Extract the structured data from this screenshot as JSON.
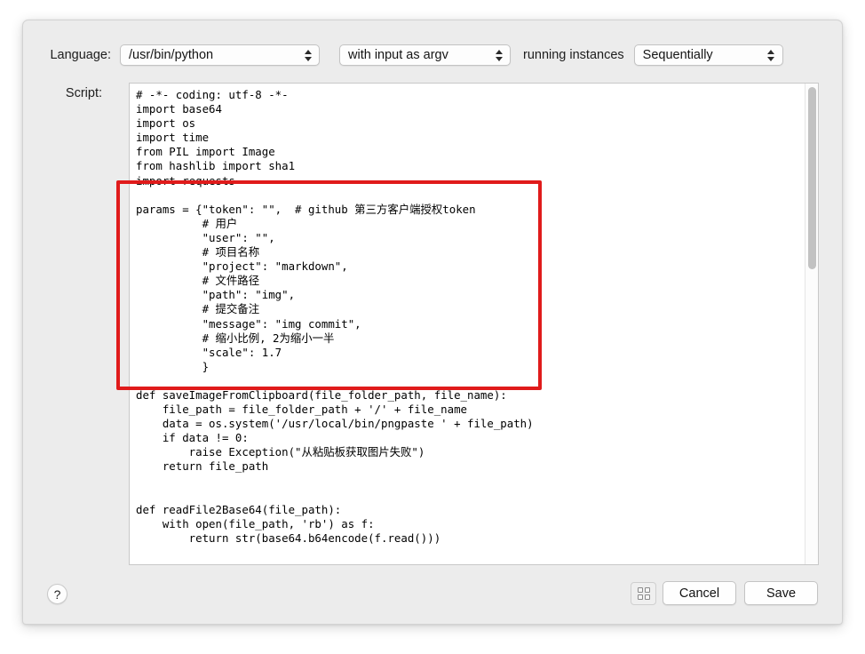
{
  "window": {
    "background_color": "#ececec"
  },
  "toolbar": {
    "language_label": "Language:",
    "language_value": "/usr/bin/python",
    "input_mode_value": "with input as argv",
    "running_instances_label": "running instances",
    "instances_value": "Sequentially",
    "chevron_icon": "chevron-up-down-icon"
  },
  "script": {
    "label": "Script:",
    "lines": [
      "# -*- coding: utf-8 -*-",
      "import base64",
      "import os",
      "import time",
      "from PIL import Image",
      "from hashlib import sha1",
      "import requests",
      "",
      "params = {\"token\": \"\",  # github 第三方客户端授权token",
      "          # 用户",
      "          \"user\": \"\",",
      "          # 项目名称",
      "          \"project\": \"markdown\",",
      "          # 文件路径",
      "          \"path\": \"img\",",
      "          # 提交备注",
      "          \"message\": \"img commit\",",
      "          # 缩小比例, 2为缩小一半",
      "          \"scale\": 1.7",
      "          }",
      "",
      "def saveImageFromClipboard(file_folder_path, file_name):",
      "    file_path = file_folder_path + '/' + file_name",
      "    data = os.system('/usr/local/bin/pngpaste ' + file_path)",
      "    if data != 0:",
      "        raise Exception(\"从粘贴板获取图片失败\")",
      "    return file_path",
      "",
      "",
      "def readFile2Base64(file_path):",
      "    with open(file_path, 'rb') as f:",
      "        return str(base64.b64encode(f.read()))"
    ]
  },
  "annotation": {
    "highlight_color": "#e01b1b",
    "description": "red rectangle around params block"
  },
  "footer": {
    "help_label": "?",
    "grid_icon": "grid-2x2-icon",
    "cancel_label": "Cancel",
    "save_label": "Save"
  }
}
